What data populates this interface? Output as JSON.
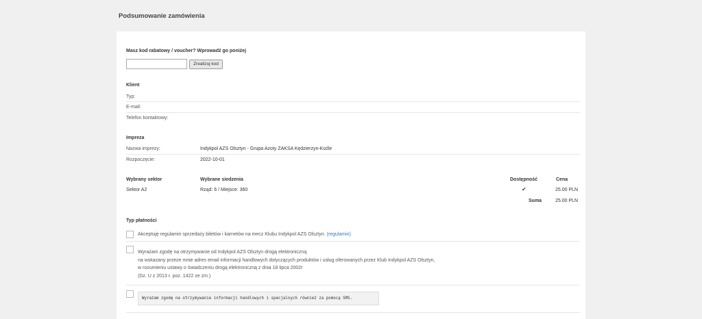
{
  "page": {
    "title": "Podsumowanie zamówienia"
  },
  "voucher": {
    "heading": "Masz kod rabatowy / voucher? Wprowadź go poniżej",
    "input_value": "",
    "button_label": "Zrealizuj kod"
  },
  "client": {
    "heading": "Klient",
    "type_label": "Typ:",
    "email_label": "E-mail:",
    "phone_label": "Telefon kontaktowy:"
  },
  "event": {
    "heading": "Impreza",
    "name_label": "Nazwa imprezy:",
    "name_value": "Indykpol AZS Olsztyn - Grupa Azoty ZAKSA Kędzierzyn-Koźle",
    "start_label": "Rozpoczęcie:",
    "start_value": "2022-10-01"
  },
  "seats": {
    "col_sector": "Wybrany sektor",
    "col_seats": "Wybrane siedzenia",
    "col_availability": "Dostępność",
    "col_price": "Cena",
    "rows": [
      {
        "sector": "Sektor A2",
        "seat": "Rząd: 6 / Miejsce: 360",
        "available_icon": "check-icon",
        "price": "25.00 PLN"
      }
    ],
    "sum_label": "Suma",
    "sum_value": "25.00 PLN"
  },
  "payment": {
    "heading": "Typ płatności",
    "consent_rules": "Akceptuję regulamin sprzedaży biletów i karnetów na mecz Klubu Indykpol AZS Olsztyn.",
    "consent_rules_link": "(regulamin)",
    "consent_marketing_lines": [
      "Wyrażam zgodę na otrzymywanie od Indykpol AZS Olsztyn drogą elektroniczną",
      "na wskazany przeze mnie adres email informacji handlowych dotyczących produktów i usług oferowanych przez Klub Indykpol AZS Olsztyn,",
      "w rozumieniu ustawy o świadczeniu drogą elektroniczną z dnia 18 lipca 2002r",
      "(Dz. U z 2013 r. poz. 1422 ze zm.)"
    ],
    "consent_sms": "Wyrażam zgodę na otrzymywanie informacji handlowych i specjalnych również za pomocą SMS."
  },
  "colors": {
    "background": "#f0f0f0",
    "panel": "#ffffff",
    "link": "#2a7ac7"
  }
}
